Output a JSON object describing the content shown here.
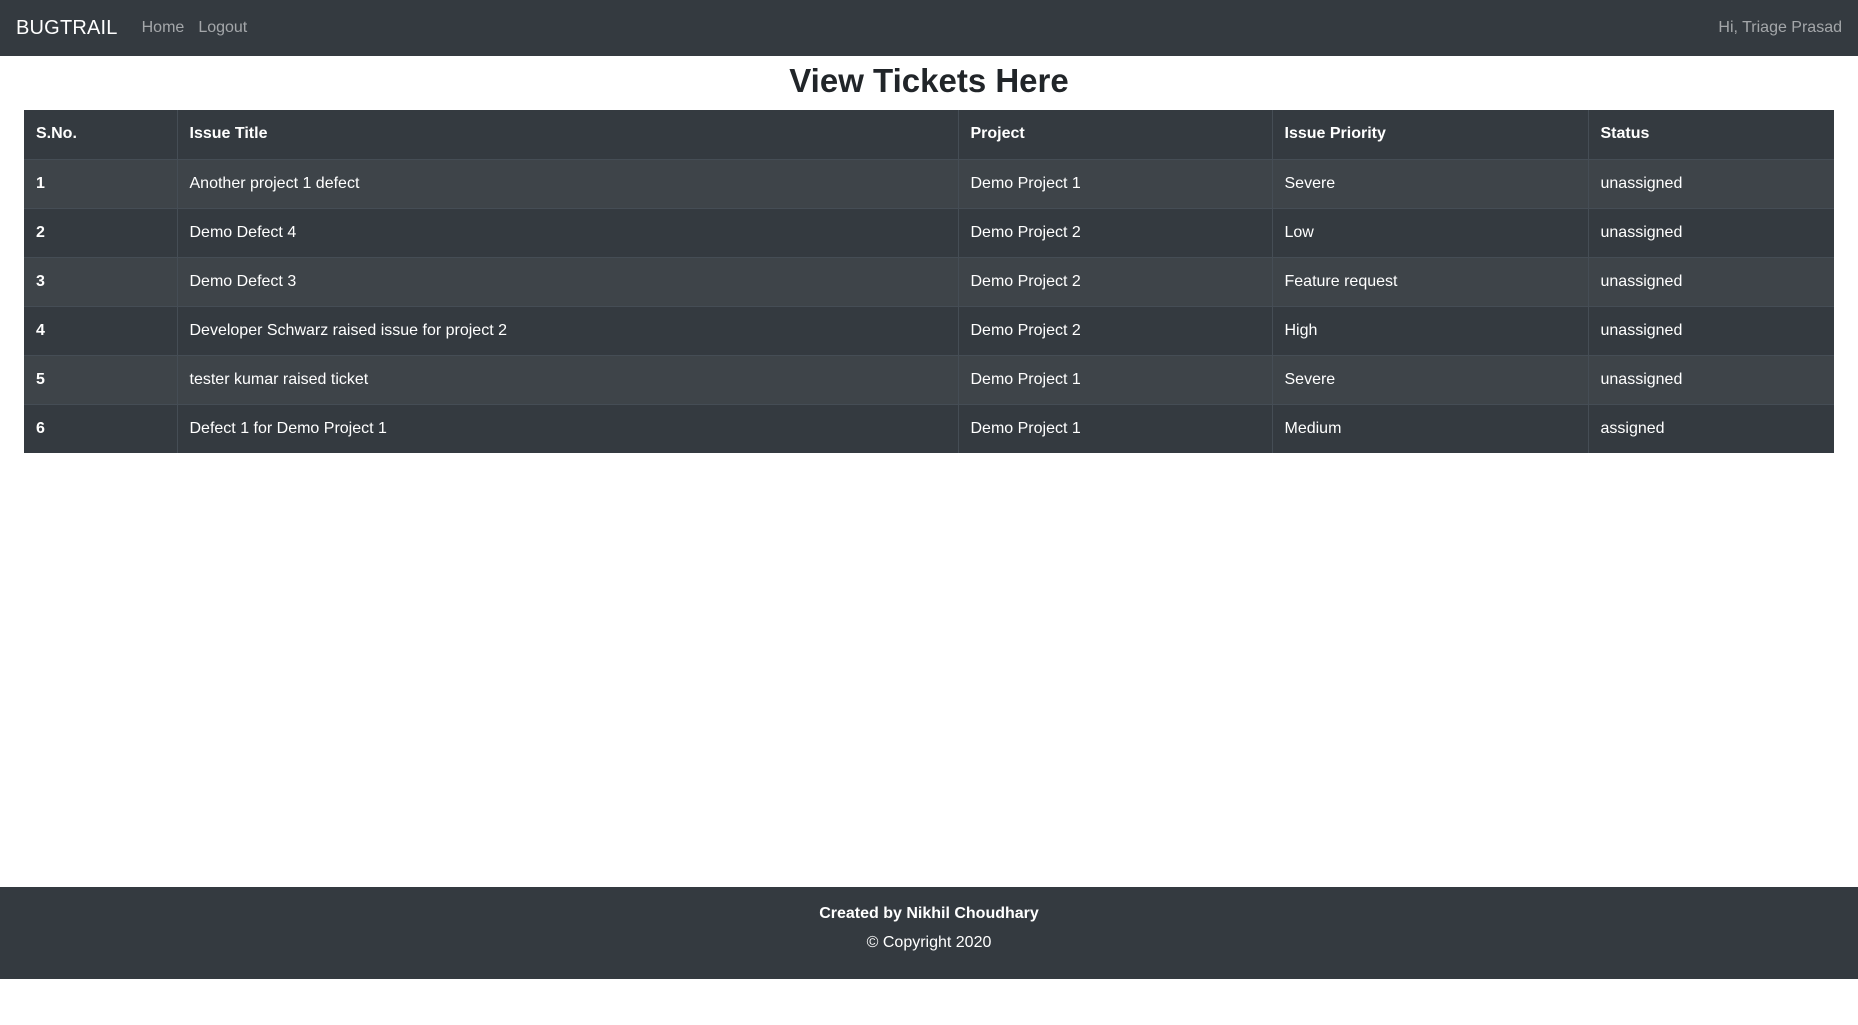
{
  "navbar": {
    "brand": "BUGTRAIL",
    "links": [
      "Home",
      "Logout"
    ],
    "greeting": "Hi, Triage Prasad"
  },
  "page": {
    "title": "View Tickets Here"
  },
  "table": {
    "headers": [
      "S.No.",
      "Issue Title",
      "Project",
      "Issue Priority",
      "Status"
    ],
    "rows": [
      [
        "1",
        "Another project 1 defect",
        "Demo Project 1",
        "Severe",
        "unassigned"
      ],
      [
        "2",
        "Demo Defect 4",
        "Demo Project 2",
        "Low",
        "unassigned"
      ],
      [
        "3",
        "Demo Defect 3",
        "Demo Project 2",
        "Feature request",
        "unassigned"
      ],
      [
        "4",
        "Developer Schwarz raised issue for project 2",
        "Demo Project 2",
        "High",
        "unassigned"
      ],
      [
        "5",
        "tester kumar raised ticket",
        "Demo Project 1",
        "Severe",
        "unassigned"
      ],
      [
        "6",
        "Defect 1 for Demo Project 1",
        "Demo Project 1",
        "Medium",
        "assigned"
      ]
    ]
  },
  "footer": {
    "credit": "Created by Nikhil Choudhary",
    "copyright": "© Copyright 2020"
  },
  "colors": {
    "navbar_bg": "#343a40",
    "table_bg": "#343a40",
    "footer_bg": "#343a40"
  }
}
